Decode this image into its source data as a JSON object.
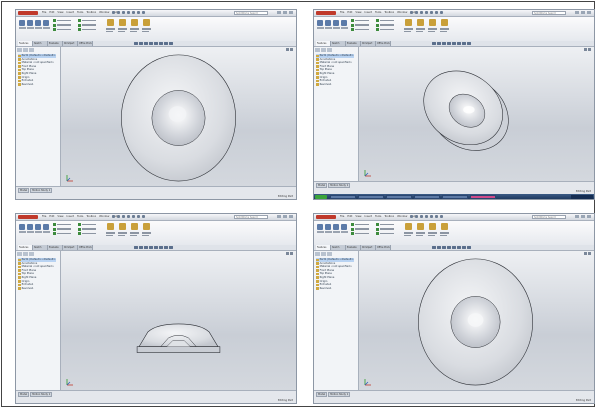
{
  "panels": [
    {
      "id": "top-left",
      "app_logo": "SolidWorks",
      "menu": [
        "File",
        "Edit",
        "View",
        "Insert",
        "Tools",
        "Toolbox",
        "Window",
        "Help"
      ],
      "search_placeholder": "SolidWorks Search",
      "tabs": [
        "Features",
        "Sketch",
        "Evaluate",
        "DimXpert",
        "Office Products"
      ],
      "tree": [
        "Part1 (Default<<Default>",
        "Annotations",
        "Material <not specified>",
        "Front Plane",
        "Top Plane",
        "Right Plane",
        "Origin",
        "Extrude1",
        "Revolve1"
      ],
      "status_tabs": [
        "Model",
        "Motion Study 1"
      ],
      "status_right": "Editing Part",
      "view": "front"
    },
    {
      "id": "top-right",
      "app_logo": "SolidWorks",
      "menu": [
        "File",
        "Edit",
        "View",
        "Insert",
        "Tools",
        "Toolbox",
        "Window",
        "Help"
      ],
      "search_placeholder": "SolidWorks Search",
      "tabs": [
        "Features",
        "Sketch",
        "Evaluate",
        "DimXpert",
        "Office Products"
      ],
      "tree": [
        "Part1 (Default<<Default>",
        "Annotations",
        "Material <not specified>",
        "Front Plane",
        "Top Plane",
        "Right Plane",
        "Origin",
        "Extrude1",
        "Revolve1"
      ],
      "status_tabs": [
        "Model",
        "Motion Study 1"
      ],
      "status_right": "Editing Part",
      "view": "isometric",
      "taskbar": true
    },
    {
      "id": "bottom-left",
      "app_logo": "SolidWorks",
      "menu": [
        "File",
        "Edit",
        "View",
        "Insert",
        "Tools",
        "Toolbox",
        "Window",
        "Help"
      ],
      "search_placeholder": "SolidWorks Search",
      "tabs": [
        "Features",
        "Sketch",
        "Evaluate",
        "DimXpert",
        "Office Products"
      ],
      "tree": [
        "Part1 (Default<<Default>",
        "Annotations",
        "Material <not specified>",
        "Front Plane",
        "Top Plane",
        "Right Plane",
        "Origin",
        "Extrude1",
        "Revolve1"
      ],
      "status_tabs": [
        "Model",
        "Motion Study 1"
      ],
      "status_right": "Editing Part",
      "view": "section"
    },
    {
      "id": "bottom-right",
      "app_logo": "SolidWorks",
      "menu": [
        "File",
        "Edit",
        "View",
        "Insert",
        "Tools",
        "Toolbox",
        "Window",
        "Help"
      ],
      "search_placeholder": "SolidWorks Search",
      "tabs": [
        "Features",
        "Sketch",
        "Evaluate",
        "DimXpert",
        "Office Products"
      ],
      "tree": [
        "Part1 (Default<<Default>",
        "Annotations",
        "Material <not specified>",
        "Front Plane",
        "Top Plane",
        "Right Plane",
        "Origin",
        "Extrude1",
        "Revolve1"
      ],
      "status_tabs": [
        "Model",
        "Motion Study 1"
      ],
      "status_right": "Editing Part",
      "view": "top"
    }
  ],
  "colors": {
    "logo": "#c0392b",
    "viewport_top": "#eef0f3",
    "viewport_bottom": "#c9ced6",
    "part_edge": "#2a2d33"
  }
}
